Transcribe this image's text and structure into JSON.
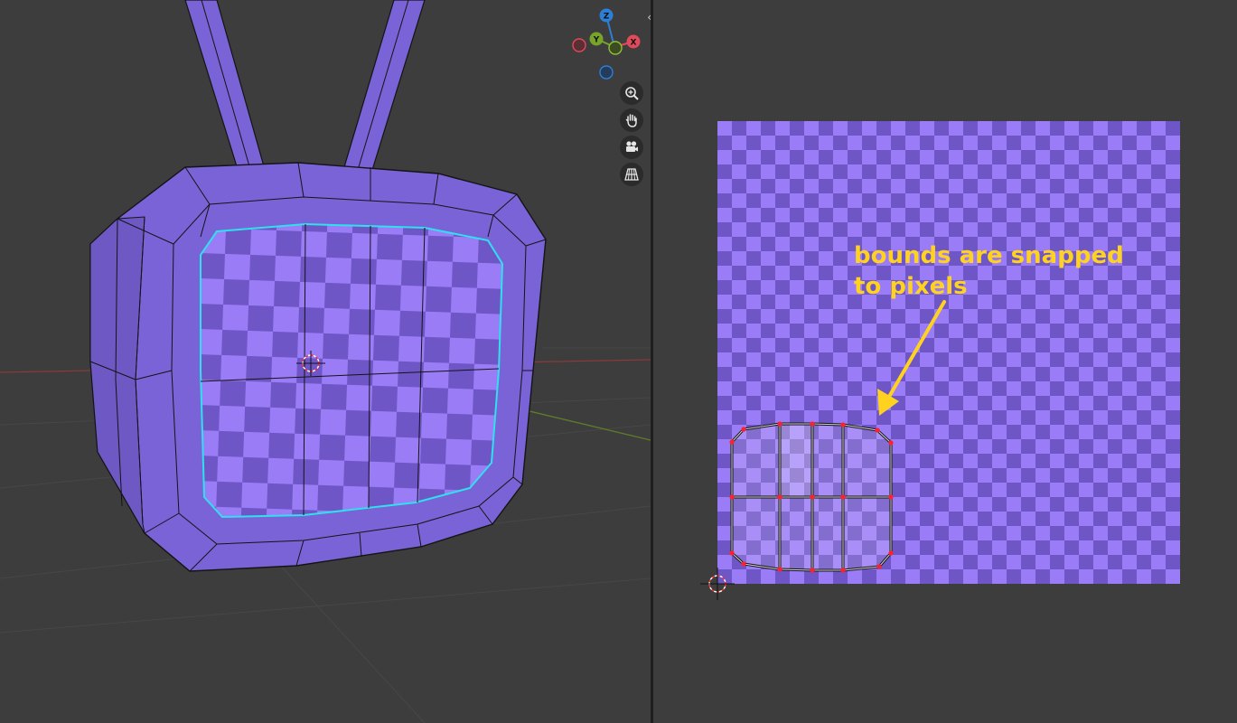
{
  "viewport3d": {
    "gizmo_axes": {
      "z": "Z",
      "y": "Y",
      "x": "X"
    },
    "navigation_buttons": [
      {
        "name": "zoom-button",
        "icon": "magnifier-plus-icon"
      },
      {
        "name": "pan-button",
        "icon": "hand-icon"
      },
      {
        "name": "camera-view-button",
        "icon": "camera-icon"
      },
      {
        "name": "ortho-toggle-button",
        "icon": "grid-icon"
      }
    ],
    "split_toggle_icon": "‹›"
  },
  "uv_editor": {
    "annotation": {
      "line1": "bounds are snapped",
      "line2": "to pixels"
    }
  },
  "colors": {
    "background": "#3d3d3d",
    "mesh_face": "#7a63d6",
    "checker_light": "#9b7cf7",
    "checker_dark": "#6f56c6",
    "selection_outline": "#2fe0ee",
    "uv_vertex": "#ff1f2f",
    "annotation": "#ffd21f",
    "axis_x": "#e04a5a",
    "axis_y": "#78a42a",
    "axis_z": "#2d7fd6"
  }
}
